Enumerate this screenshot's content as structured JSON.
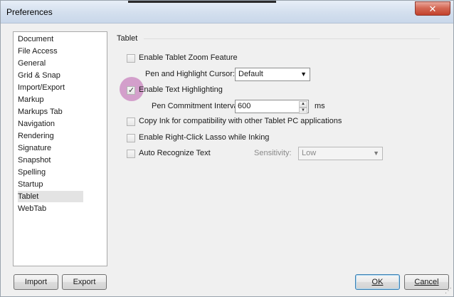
{
  "window": {
    "title": "Preferences",
    "close_glyph": "✕"
  },
  "nav": {
    "items": [
      {
        "label": "Document"
      },
      {
        "label": "File Access"
      },
      {
        "label": "General"
      },
      {
        "label": "Grid & Snap"
      },
      {
        "label": "Import/Export"
      },
      {
        "label": "Markup"
      },
      {
        "label": "Markups Tab"
      },
      {
        "label": "Navigation"
      },
      {
        "label": "Rendering"
      },
      {
        "label": "Signature"
      },
      {
        "label": "Snapshot"
      },
      {
        "label": "Spelling"
      },
      {
        "label": "Startup"
      },
      {
        "label": "Tablet",
        "selected": true
      },
      {
        "label": "WebTab"
      }
    ]
  },
  "tablet": {
    "section_title": "Tablet",
    "zoom_feature": {
      "label": "Enable Tablet Zoom Feature",
      "checked": false
    },
    "pen_cursor": {
      "label": "Pen and Highlight Cursor:",
      "value": "Default"
    },
    "text_highlighting": {
      "label": "Enable Text Highlighting",
      "checked": true
    },
    "pen_commitment": {
      "label": "Pen Commitment Interval:",
      "value": "600",
      "unit": "ms"
    },
    "copy_ink": {
      "label": "Copy Ink for compatibility with other Tablet PC applications",
      "checked": false
    },
    "right_click_lasso": {
      "label": "Enable Right-Click Lasso while Inking",
      "checked": false
    },
    "auto_recognize": {
      "label": "Auto Recognize Text",
      "checked": false
    },
    "sensitivity": {
      "label": "Sensitivity:",
      "value": "Low",
      "disabled": true
    }
  },
  "buttons": {
    "import": "Import",
    "export": "Export",
    "ok": "OK",
    "cancel": "Cancel"
  },
  "icons": {
    "checkmark": "✓",
    "dropdown": "▼",
    "spin_up": "▲",
    "spin_down": "▼"
  }
}
